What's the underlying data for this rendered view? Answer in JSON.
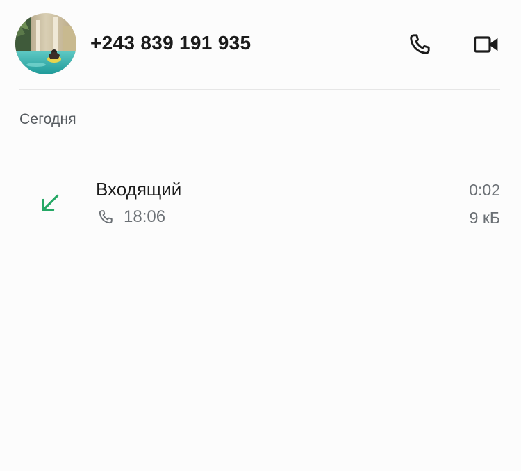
{
  "header": {
    "contact_name": "+243 839 191 935",
    "avatar_icon": "contact-photo",
    "voice_call_icon": "phone-icon",
    "video_call_icon": "video-camera-icon"
  },
  "section": {
    "label": "Сегодня"
  },
  "calls": [
    {
      "direction_icon": "incoming-arrow-icon",
      "direction_color": "#25a865",
      "type": "Входящий",
      "call_icon": "phone-icon",
      "time": "18:06",
      "duration": "0:02",
      "size": "9 кБ"
    }
  ],
  "colors": {
    "background": "#fcfcfc",
    "text_primary": "#1c1c1c",
    "text_secondary": "#6b7075",
    "accent_green": "#25a865",
    "divider": "#e6e6e6"
  }
}
